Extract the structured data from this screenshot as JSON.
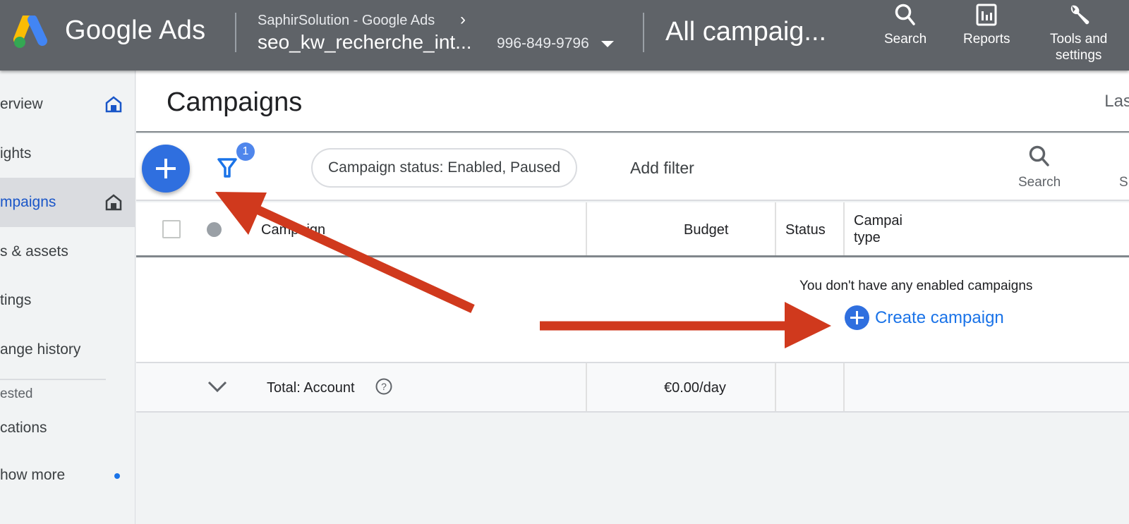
{
  "app": {
    "logo_text": "Google Ads",
    "breadcrumb_manager": "SaphirSolution - Google Ads",
    "account_name": "seo_kw_recherche_int...",
    "account_id": "996-849-9796",
    "campaign_scope": "All campaig..."
  },
  "top_actions": [
    {
      "label": "Search",
      "icon": "search-icon"
    },
    {
      "label": "Reports",
      "icon": "reports-icon"
    },
    {
      "label": "Tools and",
      "label2": "settings",
      "icon": "wrench-icon"
    }
  ],
  "sidebar": {
    "items": [
      {
        "label": "erview",
        "icon": "home-icon-filled-blue"
      },
      {
        "label": "ights"
      },
      {
        "label": "mpaigns",
        "icon": "home-icon-dark",
        "active": true
      },
      {
        "label": "s & assets"
      },
      {
        "label": "tings"
      },
      {
        "label": "ange history"
      }
    ],
    "section_label": "ested",
    "extra_items": [
      {
        "label": "cations"
      },
      {
        "label": "how more",
        "has_dot": true
      }
    ]
  },
  "page": {
    "title": "Campaigns",
    "date_range_partial": "Las"
  },
  "toolbar": {
    "filter_count": "1",
    "filter_chip": "Campaign status: Enabled, Paused",
    "add_filter": "Add filter",
    "search_label": "Search",
    "next_tool_partial": "S"
  },
  "table": {
    "columns": [
      "Campaign",
      "Budget",
      "Status",
      "Campai",
      "type"
    ],
    "empty_message": "You don't have any enabled campaigns",
    "create_link": "Create campaign",
    "total_row": {
      "label": "Total: Account",
      "budget": "€0.00/day"
    }
  },
  "colors": {
    "topbar": "#5f6368",
    "accent_blue": "#1a73e8",
    "fab_blue": "#2f6fdf",
    "annotation_red": "#d0391d"
  }
}
